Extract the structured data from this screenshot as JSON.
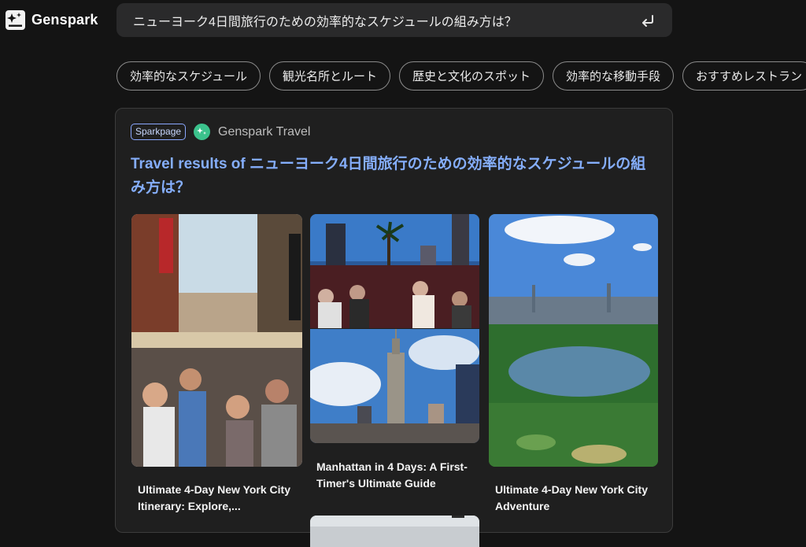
{
  "brand": {
    "name": "Genspark",
    "icon": "sparkle-logo-icon"
  },
  "search": {
    "query": "ニューヨーク4日間旅行のための効率的なスケジュールの組み方は？",
    "submit_icon": "enter-return-icon"
  },
  "chips": [
    {
      "label": "効率的なスケジュール"
    },
    {
      "label": "観光名所とルート"
    },
    {
      "label": "歴史と文化のスポット"
    },
    {
      "label": "効率的な移動手段"
    },
    {
      "label": "おすすめレストラン"
    }
  ],
  "result_card": {
    "badge": "Sparkpage",
    "source": "Genspark Travel",
    "title": "Travel results of ニューヨーク4日間旅行のための効率的なスケジュールの組み方は？",
    "results": [
      {
        "title": "Ultimate 4-Day New York City Itinerary: Explore,..."
      },
      {
        "title": "Manhattan in 4 Days: A First-Timer's Ultimate Guide"
      },
      {
        "title": "Ultimate 4-Day New York City Adventure"
      }
    ]
  },
  "colors": {
    "background": "#141414",
    "accent_title": "#85aefb",
    "badge_border": "#8aa8ff",
    "source_icon": "#3bc28c"
  }
}
